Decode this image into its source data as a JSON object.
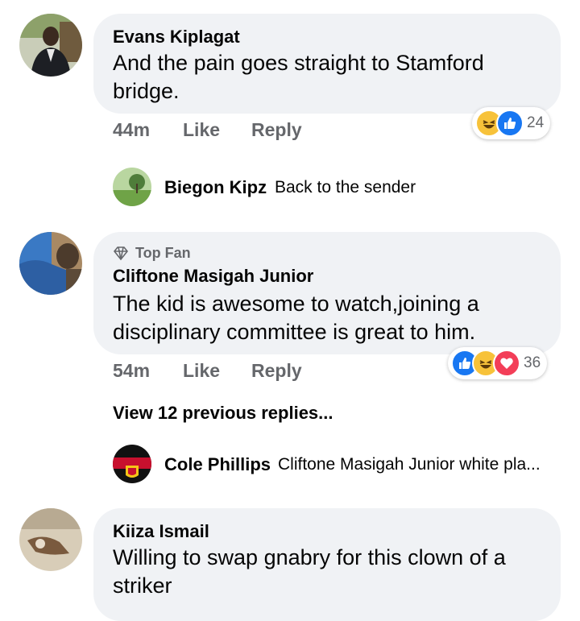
{
  "comments": [
    {
      "author": "Evans Kiplagat",
      "text": "And the pain goes straight to Stamford bridge.",
      "time": "44m",
      "like_label": "Like",
      "reply_label": "Reply",
      "reaction_count": "24",
      "reactions": [
        "haha-icon",
        "like-icon"
      ],
      "reply": {
        "author": "Biegon Kipz",
        "text": "Back to the sender"
      }
    },
    {
      "badge": "Top Fan",
      "author": "Cliftone Masigah Junior",
      "text": "The kid is awesome to watch,joining a disciplinary committee is great to him.",
      "time": "54m",
      "like_label": "Like",
      "reply_label": "Reply",
      "reaction_count": "36",
      "reactions": [
        "like-icon",
        "haha-icon",
        "love-icon"
      ],
      "view_previous": "View 12 previous replies...",
      "reply": {
        "author": "Cole Phillips",
        "text": "Cliftone Masigah Junior white pla..."
      }
    },
    {
      "author": "Kiiza Ismail",
      "text": "Willing to swap gnabry for this clown of a striker"
    }
  ],
  "colors": {
    "bubble": "#f0f2f5",
    "meta_text": "#65676b",
    "like_blue": "#1877f2",
    "haha_yellow": "#f7c23a",
    "love_red": "#f33e58"
  }
}
